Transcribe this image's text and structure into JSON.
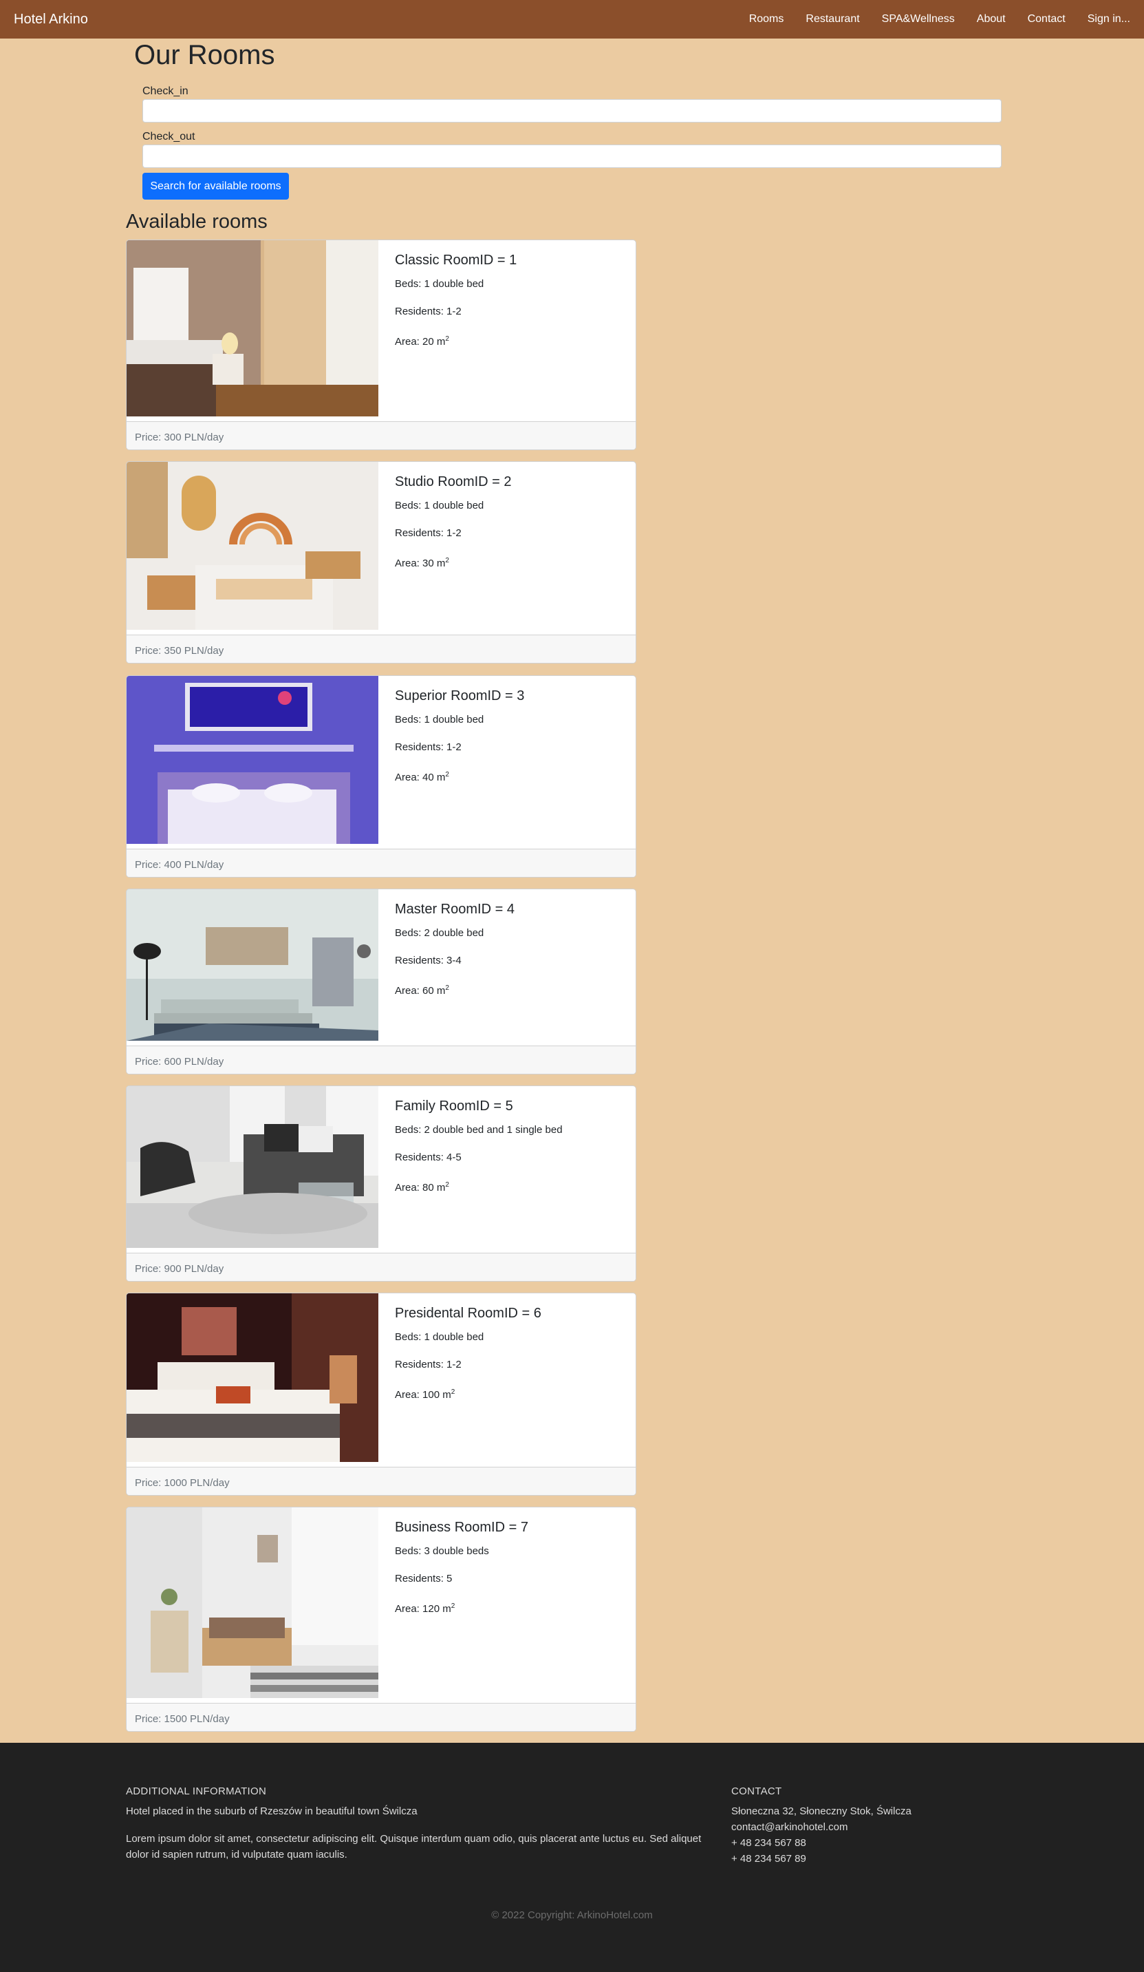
{
  "navbar": {
    "brand": "Hotel Arkino",
    "links": [
      "Rooms",
      "Restaurant",
      "SPA&Wellness",
      "About",
      "Contact",
      "Sign in..."
    ]
  },
  "page": {
    "title": "Our Rooms",
    "check_in_label": "Check_in",
    "check_out_label": "Check_out",
    "check_in_value": "",
    "check_out_value": "",
    "search_button": "Search for available rooms",
    "available_title": "Available rooms"
  },
  "rooms": [
    {
      "title": "Classic RoomID = 1",
      "beds": "Beds: 1 double bed",
      "residents": "Residents: 1-2",
      "area": "Area: 20 m",
      "area_sup": "2",
      "price": "Price: 300 PLN/day"
    },
    {
      "title": "Studio RoomID = 2",
      "beds": "Beds: 1 double bed",
      "residents": "Residents: 1-2",
      "area": "Area: 30 m",
      "area_sup": "2",
      "price": "Price: 350 PLN/day"
    },
    {
      "title": "Superior RoomID = 3",
      "beds": "Beds: 1 double bed",
      "residents": "Residents: 1-2",
      "area": "Area: 40 m",
      "area_sup": "2",
      "price": "Price: 400 PLN/day"
    },
    {
      "title": "Master RoomID = 4",
      "beds": "Beds: 2 double bed",
      "residents": "Residents: 3-4",
      "area": "Area: 60 m",
      "area_sup": "2",
      "price": "Price: 600 PLN/day"
    },
    {
      "title": "Family RoomID = 5",
      "beds": "Beds: 2 double bed and 1 single bed",
      "residents": "Residents: 4-5",
      "area": "Area: 80 m",
      "area_sup": "2",
      "price": "Price: 900 PLN/day"
    },
    {
      "title": "Presidental RoomID = 6",
      "beds": "Beds: 1 double bed",
      "residents": "Residents: 1-2",
      "area": "Area: 100 m",
      "area_sup": "2",
      "price": "Price: 1000 PLN/day"
    },
    {
      "title": "Business RoomID = 7",
      "beds": "Beds: 3 double beds",
      "residents": "Residents: 5",
      "area": "Area: 120 m",
      "area_sup": "2",
      "price": "Price: 1500 PLN/day"
    }
  ],
  "footer": {
    "info_heading": "Additional information",
    "info_line1": "Hotel placed in the suburb of Rzeszów in beautiful town Świlcza",
    "info_line2": "Lorem ipsum dolor sit amet, consectetur adipiscing elit. Quisque interdum quam odio, quis placerat ante luctus eu. Sed aliquet dolor id sapien rutrum, id vulputate quam iaculis.",
    "contact_heading": "Contact",
    "address": "Słoneczna 32, Słoneczny Stok, Świlcza",
    "email": "contact@arkinohotel.com",
    "phone1": "+ 48 234 567 88",
    "phone2": "+ 48 234 567 89",
    "copyright": "© 2022 Copyright: ArkinoHotel.com"
  },
  "colors": {
    "navbar": "#8b4f2b",
    "background": "#ebcba1",
    "button": "#0d6efd",
    "footer": "#212121"
  }
}
